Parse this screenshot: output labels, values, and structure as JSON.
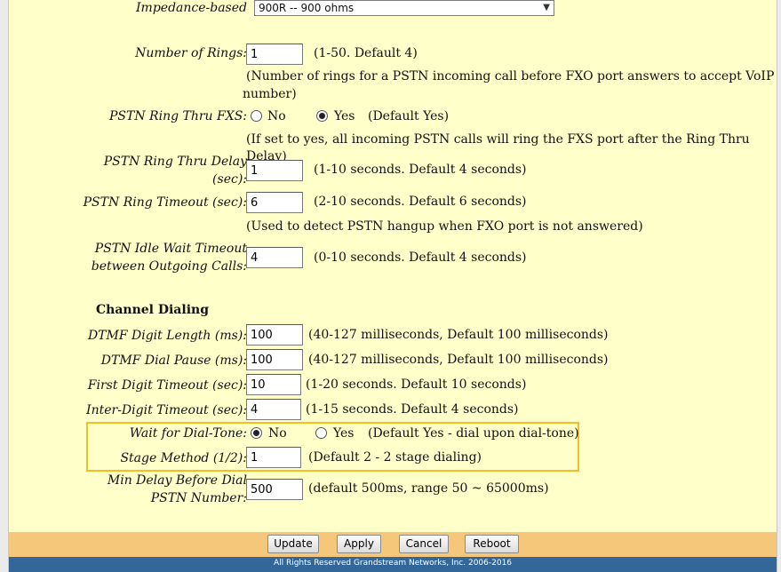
{
  "impedance": {
    "label": "Impedance-based",
    "value": "900R -- 900 ohms"
  },
  "rings": {
    "label": "Number of Rings:",
    "value": "1",
    "hint": "(1-50. Default 4)",
    "note_line1": "(Number of rings for a PSTN incoming call before FXO port answers to accept VoIP",
    "note_line2": "number)"
  },
  "ring_thru": {
    "label": "PSTN Ring Thru FXS:",
    "no": "No",
    "yes": "Yes",
    "hint": "(Default Yes)",
    "selected": "yes",
    "note": "(If set to yes, all incoming PSTN calls will ring the FXS port after the Ring Thru Delay)"
  },
  "ring_thru_delay": {
    "label_line1": "PSTN Ring Thru Delay",
    "label_line2": "(sec):",
    "value": "1",
    "hint": "(1-10 seconds. Default 4 seconds)"
  },
  "ring_timeout": {
    "label": "PSTN Ring Timeout (sec):",
    "value": "6",
    "hint": "(2-10 seconds. Default 6 seconds)",
    "note": "(Used to detect PSTN hangup when FXO port is not answered)"
  },
  "idle_wait": {
    "label_line1": "PSTN Idle Wait Timeout",
    "label_line2": "between Outgoing Calls:",
    "value": "4",
    "hint": "(0-10 seconds. Default 4 seconds)"
  },
  "channel_dialing": {
    "heading": "Channel Dialing",
    "dtmf_length": {
      "label": "DTMF Digit Length (ms):",
      "value": "100",
      "hint": "(40-127 milliseconds, Default 100 milliseconds)"
    },
    "dtmf_pause": {
      "label": "DTMF Dial Pause (ms):",
      "value": "100",
      "hint": "(40-127 milliseconds, Default 100 milliseconds)"
    },
    "first_digit": {
      "label": "First Digit Timeout (sec):",
      "value": "10",
      "hint": "(1-20 seconds. Default 10 seconds)"
    },
    "inter_digit": {
      "label": "Inter-Digit Timeout (sec):",
      "value": "4",
      "hint": "(1-15 seconds. Default 4 seconds)"
    },
    "wait_dial_tone": {
      "label": "Wait for Dial-Tone:",
      "no": "No",
      "yes": "Yes",
      "hint": "(Default Yes - dial upon dial-tone)",
      "selected": "no"
    },
    "stage_method": {
      "label": "Stage Method (1/2):",
      "value": "1",
      "hint": "(Default 2 - 2 stage dialing)"
    },
    "min_delay": {
      "label_line1": "Min Delay Before Dial",
      "label_line2": "PSTN Number:",
      "value": "500",
      "hint": "(default 500ms, range 50 ~ 65000ms)"
    }
  },
  "buttons": {
    "update": "Update",
    "apply": "Apply",
    "cancel": "Cancel",
    "reboot": "Reboot"
  },
  "copyright": "All Rights Reserved Grandstream Networks, Inc. 2006-2016",
  "colors": {
    "background": "#ffffc9",
    "footer": "#f5c77a",
    "copyright_bar": "#336699",
    "highlight": "#f6bc21"
  }
}
